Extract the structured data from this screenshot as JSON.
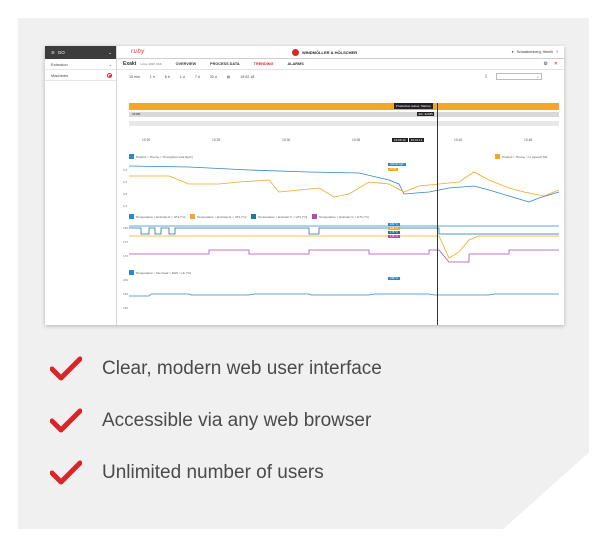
{
  "shot": {
    "sidebar": {
      "top_label": "GO",
      "items": [
        {
          "label": "Extrusion"
        },
        {
          "label": "Machines"
        }
      ]
    },
    "topbar": {
      "app_name": "ruby",
      "brand": "WINDMÖLLER & HÖLSCHER",
      "user": "Schwabenberg, Henrik"
    },
    "tabs": {
      "line": "Exakt",
      "subtitle": "Linke 1820 VAS",
      "items": [
        "OVERVIEW",
        "PROCESS DATA",
        "TRENDING",
        "ALARMS"
      ],
      "active": "TRENDING"
    },
    "filters": {
      "ranges": [
        "15 min",
        "1 h",
        "6 h",
        "1 d",
        "7 d",
        "30 d"
      ],
      "date": "19.02.18"
    },
    "timeline": {
      "production_status": "Production status: Startup",
      "job_left": "32185",
      "job_right": "Job: 32185",
      "times": [
        "10:20",
        "10:25",
        "10:30",
        "10:35",
        "10:40",
        "10:45"
      ],
      "cursor_times": [
        "10:06:12",
        "10:41:14"
      ]
    },
    "chart1": {
      "legend_left": "Product > Theme > Throughput total [kg/h]",
      "legend_right": "Product > Theme > Lt (speed) [%]",
      "yticks": [
        "1/4",
        "1/2",
        "3/4",
        "1/1"
      ],
      "badges": [
        "320.00 kg/h",
        "57 %"
      ]
    },
    "chart2": {
      "legends": [
        "Temperature > Extruder E > HT1 [°C]",
        "Temperature > Extruder E > HT1 [°C]",
        "Temperature > Extruder F > HT1 [°C]",
        "Temperature > Extruder G > HT1 [°C]"
      ],
      "yticks": [
        "180",
        "175",
        "170"
      ],
      "badges": [
        "184 °C",
        "184 °C",
        "175 °C",
        "175 °C"
      ]
    },
    "chart3": {
      "legend": "Temperature > Die head > DHS > HL [°C]",
      "yticks": [
        "200",
        "195",
        "190"
      ],
      "badges": [
        "198 °C"
      ]
    }
  },
  "features": [
    "Clear, modern web user interface",
    "Accessible via any web browser",
    "Unlimited number of users"
  ],
  "colors": {
    "accent_red": "#d7252a",
    "orange": "#f5a623",
    "blue": "#2f86c8",
    "teal": "#1f7a8c",
    "purple": "#b04ab4",
    "card_bg": "#f0f0f1"
  }
}
